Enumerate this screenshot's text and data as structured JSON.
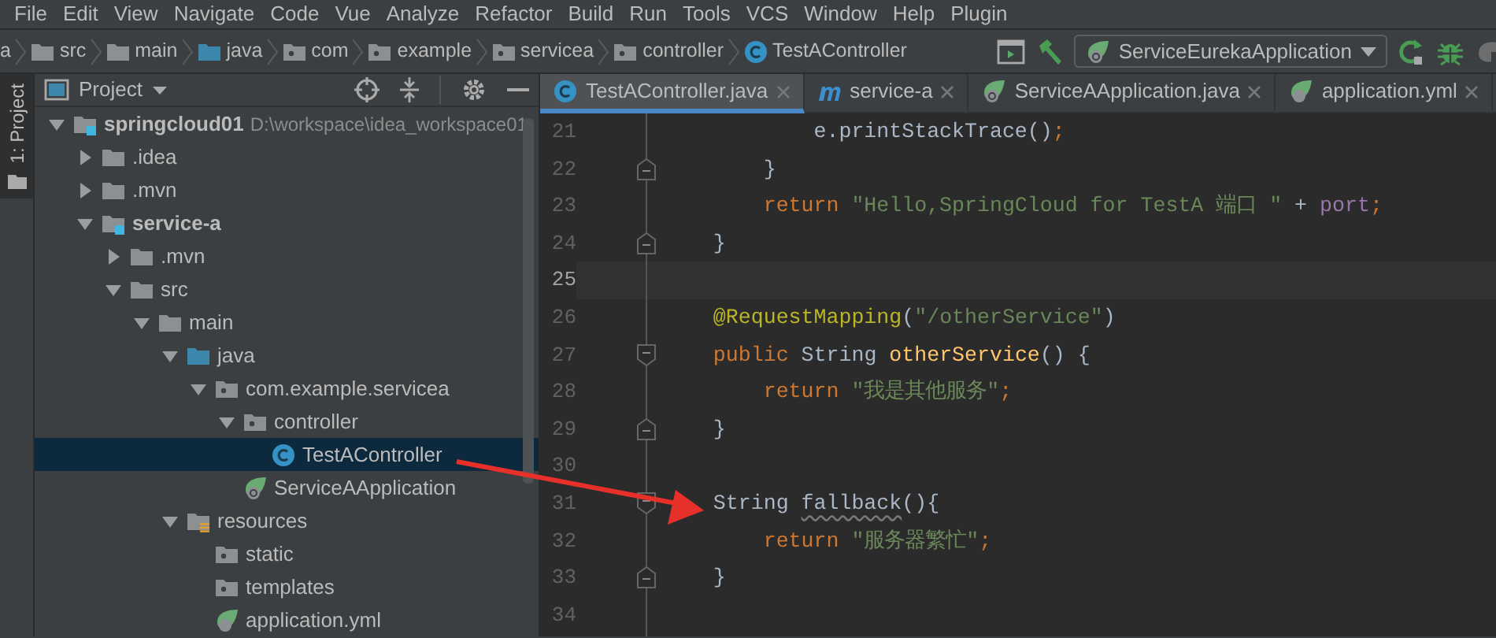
{
  "menu": [
    {
      "label": "File"
    },
    {
      "label": "Edit"
    },
    {
      "label": "View"
    },
    {
      "label": "Navigate"
    },
    {
      "label": "Code"
    },
    {
      "label": "Vue"
    },
    {
      "label": "Analyze"
    },
    {
      "label": "Refactor"
    },
    {
      "label": "Build"
    },
    {
      "label": "Run"
    },
    {
      "label": "Tools"
    },
    {
      "label": "VCS"
    },
    {
      "label": "Window"
    },
    {
      "label": "Help"
    },
    {
      "label": "Plugin"
    }
  ],
  "breadcrumbs": [
    {
      "label": "a",
      "kind": "text"
    },
    {
      "label": "src",
      "kind": "folder"
    },
    {
      "label": "main",
      "kind": "folder"
    },
    {
      "label": "java",
      "kind": "source"
    },
    {
      "label": "com",
      "kind": "package"
    },
    {
      "label": "example",
      "kind": "package"
    },
    {
      "label": "servicea",
      "kind": "package"
    },
    {
      "label": "controller",
      "kind": "package"
    },
    {
      "label": "TestAController",
      "kind": "class"
    }
  ],
  "run_config": {
    "label": "ServiceEurekaApplication"
  },
  "tool_strip": {
    "label": "1: Project"
  },
  "project_panel": {
    "title": "Project",
    "tree": [
      {
        "label": "springcloud01",
        "path": "D:\\workspace\\idea_workspace01",
        "kind": "module",
        "bold": true,
        "expanded": true,
        "selected": false,
        "children": [
          {
            "label": ".idea",
            "kind": "folder",
            "bold": false,
            "expanded": false,
            "selected": false
          },
          {
            "label": ".mvn",
            "kind": "folder",
            "bold": false,
            "expanded": false,
            "selected": false
          },
          {
            "label": "service-a",
            "kind": "module",
            "bold": true,
            "expanded": true,
            "selected": false,
            "children": [
              {
                "label": ".mvn",
                "kind": "folder",
                "bold": false,
                "expanded": false,
                "selected": false
              },
              {
                "label": "src",
                "kind": "folder",
                "bold": false,
                "expanded": true,
                "selected": false,
                "children": [
                  {
                    "label": "main",
                    "kind": "folder",
                    "bold": false,
                    "expanded": true,
                    "selected": false,
                    "children": [
                      {
                        "label": "java",
                        "kind": "source",
                        "bold": false,
                        "expanded": true,
                        "selected": false,
                        "children": [
                          {
                            "label": "com.example.servicea",
                            "kind": "package",
                            "bold": false,
                            "expanded": true,
                            "selected": false,
                            "children": [
                              {
                                "label": "controller",
                                "kind": "package",
                                "bold": false,
                                "expanded": true,
                                "selected": false,
                                "children": [
                                  {
                                    "label": "TestAController",
                                    "kind": "class",
                                    "bold": false,
                                    "selected": true
                                  }
                                ]
                              },
                              {
                                "label": "ServiceAApplication",
                                "kind": "spring",
                                "bold": false,
                                "selected": false
                              }
                            ]
                          }
                        ]
                      },
                      {
                        "label": "resources",
                        "kind": "resources",
                        "bold": false,
                        "expanded": true,
                        "selected": false,
                        "children": [
                          {
                            "label": "static",
                            "kind": "package",
                            "bold": false,
                            "selected": false
                          },
                          {
                            "label": "templates",
                            "kind": "package",
                            "bold": false,
                            "selected": false
                          },
                          {
                            "label": "application.yml",
                            "kind": "yaml",
                            "bold": false,
                            "selected": false
                          }
                        ]
                      }
                    ]
                  }
                ]
              }
            ]
          }
        ]
      }
    ]
  },
  "editor": {
    "tabs": [
      {
        "label": "TestAController.java",
        "kind": "class",
        "selected": true
      },
      {
        "label": "service-a",
        "kind": "maven",
        "selected": false
      },
      {
        "label": "ServiceAApplication.java",
        "kind": "spring",
        "selected": false
      },
      {
        "label": "application.yml",
        "kind": "yaml",
        "selected": false
      }
    ],
    "lines": [
      {
        "number": "21",
        "current": false,
        "tokens": [
          {
            "kind": "plain",
            "text": "            e.printStackTrace()"
          },
          {
            "kind": "punct",
            "text": ";"
          }
        ]
      },
      {
        "number": "22",
        "current": false,
        "fold_end": true,
        "tokens": [
          {
            "kind": "plain",
            "text": "        }"
          }
        ]
      },
      {
        "number": "23",
        "current": false,
        "tokens": [
          {
            "kind": "keyword",
            "text": "        return "
          },
          {
            "kind": "string",
            "text": "\"Hello,SpringCloud for TestA 端口 \""
          },
          {
            "kind": "plain",
            "text": " + "
          },
          {
            "kind": "field",
            "text": "port"
          },
          {
            "kind": "punct",
            "text": ";"
          }
        ]
      },
      {
        "number": "24",
        "current": false,
        "fold_end": true,
        "tokens": [
          {
            "kind": "plain",
            "text": "    }"
          }
        ]
      },
      {
        "number": "25",
        "current": true
      },
      {
        "number": "26",
        "current": false,
        "tokens": [
          {
            "kind": "annotation",
            "text": "    @RequestMapping"
          },
          {
            "kind": "plain",
            "text": "("
          },
          {
            "kind": "string",
            "text": "\"/otherService\""
          },
          {
            "kind": "plain",
            "text": ")"
          }
        ]
      },
      {
        "number": "27",
        "current": false,
        "fold_start": true,
        "tokens": [
          {
            "kind": "keyword",
            "text": "    public"
          },
          {
            "kind": "plain",
            "text": " String "
          },
          {
            "kind": "decl",
            "text": "otherService"
          },
          {
            "kind": "plain",
            "text": "() {"
          }
        ]
      },
      {
        "number": "28",
        "current": false,
        "tokens": [
          {
            "kind": "keyword",
            "text": "        return "
          },
          {
            "kind": "string",
            "text": "\"我是其他服务\""
          },
          {
            "kind": "punct",
            "text": ";"
          }
        ]
      },
      {
        "number": "29",
        "current": false,
        "fold_end": true,
        "tokens": [
          {
            "kind": "plain",
            "text": "    }"
          }
        ]
      },
      {
        "number": "30",
        "current": false
      },
      {
        "number": "31",
        "current": false,
        "fold_start": true,
        "tokens": [
          {
            "kind": "plain",
            "text": "    String "
          },
          {
            "kind": "unused",
            "text": "fallback"
          },
          {
            "kind": "plain",
            "text": "(){"
          }
        ]
      },
      {
        "number": "32",
        "current": false,
        "tokens": [
          {
            "kind": "keyword",
            "text": "        return "
          },
          {
            "kind": "string",
            "text": "\"服务器繁忙\""
          },
          {
            "kind": "punct",
            "text": ";"
          }
        ]
      },
      {
        "number": "33",
        "current": false,
        "fold_end": true,
        "tokens": [
          {
            "kind": "plain",
            "text": "    }"
          }
        ]
      },
      {
        "number": "34",
        "current": false
      }
    ]
  }
}
